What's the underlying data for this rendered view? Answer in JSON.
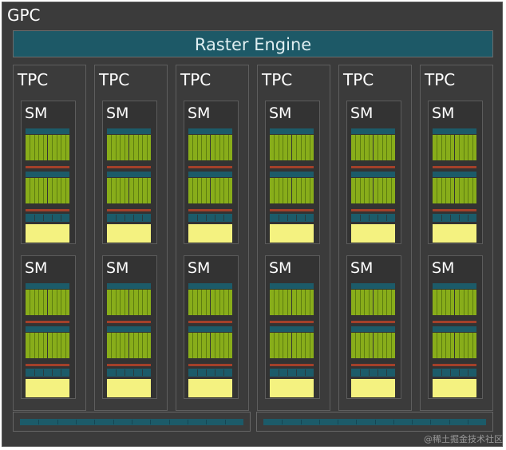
{
  "gpc": {
    "label": "GPC"
  },
  "raster_engine": {
    "label": "Raster Engine"
  },
  "tpc_label": "TPC",
  "sm_label": "SM",
  "tpc_count": 6,
  "sm_per_tpc": 2,
  "watermark": "@稀土掘金技术社区",
  "colors": {
    "background": "#3b3b3b",
    "raster_engine": "#1d5967",
    "core_green": "#88ad1a",
    "register_red": "#a3402a",
    "teal_unit": "#1c5b69",
    "l1_cache_yellow": "#f4f280"
  }
}
